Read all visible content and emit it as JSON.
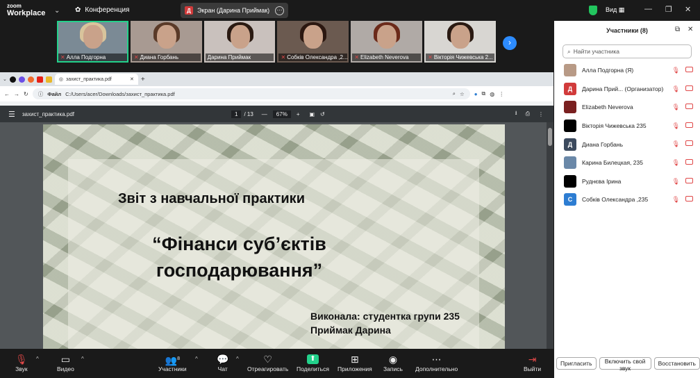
{
  "app": {
    "brand_top": "zoom",
    "brand": "Workplace",
    "meeting": "Конференция",
    "screen_share_label": "Экран (Дарина Приймак)",
    "screen_share_avatar": "Д",
    "view_label": "Вид"
  },
  "gallery": [
    {
      "name": "Алла Подгорна",
      "active": true
    },
    {
      "name": "Диана Горбань"
    },
    {
      "name": "Дарина Приймак"
    },
    {
      "name": "Собків Олександра ,2..."
    },
    {
      "name": "Elizabeth Neverova"
    },
    {
      "name": "Вікторія Чижевська 2..."
    }
  ],
  "browser": {
    "tab_title": "захист_практика.pdf",
    "url_prefix": "Файл",
    "url": "C:/Users/acer/Downloads/захист_практика.pdf"
  },
  "pdf": {
    "filename": "захист_практика.pdf",
    "page_current": "1",
    "page_total": "/ 13",
    "zoom": "67%",
    "line1": "Звіт з навчальної практики",
    "line2": "“Фінанси суб’єктів",
    "line3": "господарювання”",
    "line4": "Виконала: студентка групи 235",
    "line5": "Приймак Дарина"
  },
  "panel": {
    "title": "Участники (8)",
    "search_placeholder": "Найти участника",
    "participants": [
      {
        "name": "Алла Подгорна (Я)",
        "avatar": "",
        "color": "#b89a86"
      },
      {
        "name": "Дарина Прий...  (Организатор)",
        "avatar": "Д",
        "color": "#d13b3b"
      },
      {
        "name": "Elizabeth Neverova",
        "avatar": "",
        "color": "#7a2020"
      },
      {
        "name": "Вікторія Чижевська 235",
        "avatar": "",
        "color": "#000000"
      },
      {
        "name": "Диана Горбань",
        "avatar": "Д",
        "color": "#3c4a5e"
      },
      {
        "name": "Карина Билецкая, 235",
        "avatar": "",
        "color": "#6a88a8"
      },
      {
        "name": "Руднєва Ірина",
        "avatar": "",
        "color": "#000000"
      },
      {
        "name": "Собків Олександра ,235",
        "avatar": "С",
        "color": "#2d7dd2"
      }
    ],
    "buttons": [
      "Пригласить",
      "Включить свой звук",
      "Восстановить"
    ]
  },
  "toolbar": {
    "sound": "Звук",
    "video": "Видео",
    "participants": "Участники",
    "participants_count": "8",
    "chat": "Чат",
    "react": "Отреагировать",
    "share": "Поделиться",
    "apps": "Приложения",
    "record": "Запись",
    "more": "Дополнительно",
    "leave": "Выйти"
  }
}
